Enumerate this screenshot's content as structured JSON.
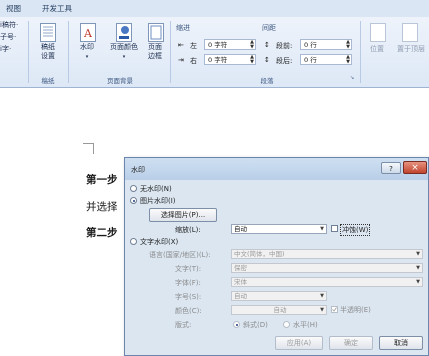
{
  "ribbon": {
    "tabs": [
      "视图",
      "开发工具"
    ],
    "left_partial": [
      "i稿符·",
      "子号·",
      "i字·"
    ],
    "manuscript_group": {
      "button": "稿纸\n设置",
      "label": "稿纸"
    },
    "page_background": {
      "buttons": [
        "水印",
        "页面颜色",
        "页面\n边框"
      ],
      "label": "页面背景"
    },
    "indent": {
      "title": "缩进",
      "left_label": "左",
      "left_value": "0 字符",
      "right_label": "右",
      "right_value": "0 字符"
    },
    "spacing": {
      "title": "间距",
      "before_label": "段前:",
      "before_value": "0 行",
      "after_label": "段后:",
      "after_value": "0 行"
    },
    "paragraph_label": "段落",
    "arrange": {
      "position": "位置",
      "wrap": "置于顶层"
    }
  },
  "document": {
    "line1": "第一步",
    "line2": "并选择",
    "line3": "第二步"
  },
  "dialog": {
    "title": "水印",
    "help_glyph": "?",
    "close_glyph": "×",
    "no_watermark": "无水印(N)",
    "picture_watermark": "图片水印(I)",
    "select_picture": "选择图片(P)...",
    "scale_label": "缩放(L):",
    "scale_value": "自动",
    "washout_label": "冲蚀(W)",
    "text_watermark": "文字水印(X)",
    "language_label": "语言(国家/地区)(L):",
    "language_value": "中文(简体，中国)",
    "text_label": "文字(T):",
    "text_value": "保密",
    "font_label": "字体(F):",
    "font_value": "宋体",
    "size_label": "字号(S):",
    "size_value": "自动",
    "color_label": "颜色(C):",
    "color_value": "自动",
    "semitransparent_label": "半透明(E)",
    "layout_label": "版式:",
    "diagonal_label": "斜式(D)",
    "horizontal_label": "水平(H)",
    "apply_button": "应用(A)",
    "ok_button": "确定",
    "cancel_button": "取消"
  }
}
